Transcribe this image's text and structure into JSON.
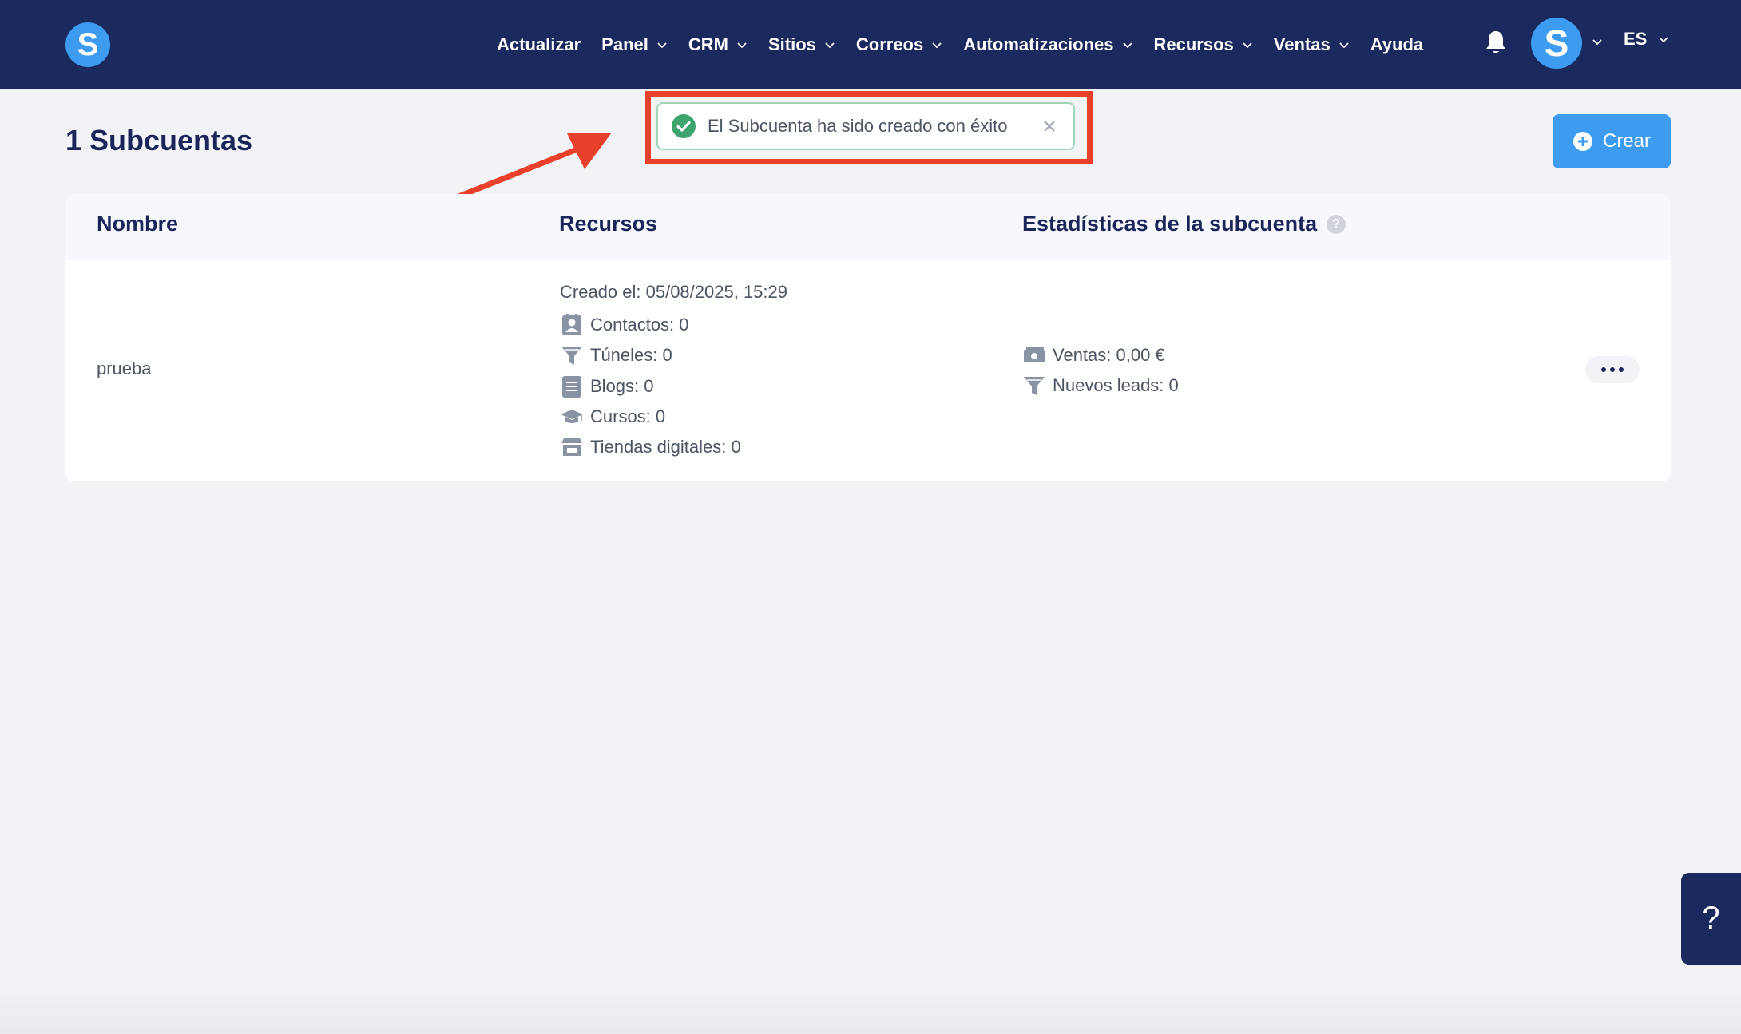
{
  "nav": {
    "logo_letter": "S",
    "items": [
      {
        "label": "Actualizar",
        "has_dropdown": false
      },
      {
        "label": "Panel",
        "has_dropdown": true
      },
      {
        "label": "CRM",
        "has_dropdown": true
      },
      {
        "label": "Sitios",
        "has_dropdown": true
      },
      {
        "label": "Correos",
        "has_dropdown": true
      },
      {
        "label": "Automatizaciones",
        "has_dropdown": true
      },
      {
        "label": "Recursos",
        "has_dropdown": true
      },
      {
        "label": "Ventas",
        "has_dropdown": true
      },
      {
        "label": "Ayuda",
        "has_dropdown": false
      }
    ],
    "bell_icon": "bell-icon",
    "avatar_letter": "S",
    "language": "ES"
  },
  "page": {
    "title": "1 Subcuentas",
    "create_label": "Crear"
  },
  "toast": {
    "message": "El Subcuenta ha sido creado con éxito",
    "status_color": "#3fa56e"
  },
  "table": {
    "headers": {
      "name": "Nombre",
      "resources": "Recursos",
      "stats": "Estadísticas de la subcuenta"
    },
    "rows": [
      {
        "name": "prueba",
        "created": "Creado el: 05/08/2025, 15:29",
        "resources": [
          {
            "icon": "contacts-icon",
            "text": "Contactos: 0"
          },
          {
            "icon": "funnel-icon",
            "text": "Túneles: 0"
          },
          {
            "icon": "blog-icon",
            "text": "Blogs: 0"
          },
          {
            "icon": "graduation-cap-icon",
            "text": "Cursos: 0"
          },
          {
            "icon": "store-icon",
            "text": "Tiendas digitales: 0"
          }
        ],
        "stats": [
          {
            "icon": "money-icon",
            "text": "Ventas: 0,00 €"
          },
          {
            "icon": "funnel-icon",
            "text": "Nuevos leads: 0"
          }
        ]
      }
    ]
  },
  "help_button": "?",
  "colors": {
    "nav_bg": "#1a2a5e",
    "brand_blue": "#3d9bf0",
    "highlight_red": "#e8402a"
  }
}
